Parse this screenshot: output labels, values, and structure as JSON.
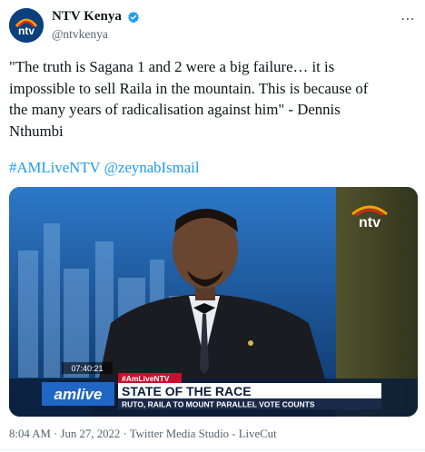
{
  "author": {
    "display_name": "NTV Kenya",
    "handle": "@ntvkenya",
    "verified": true,
    "logo_text": "ntv"
  },
  "more_icon": "ellipsis-icon",
  "tweet": {
    "text": "\"The truth is Sagana 1 and 2 were a big failure… it is\nimpossible to sell Raila in the mountain. This is because of\nthe many years of radicalisation against him\" - Dennis\nNthumbi",
    "hashtag": "#AMLiveNTV",
    "mention": "@zeynabIsmail"
  },
  "video": {
    "channel_logo": "ntv",
    "timestamp": "07:40:21",
    "show_logo": "amlive",
    "ticker_tag": "#AmLiveNTV",
    "headline": "STATE OF THE RACE",
    "subheadline": "RUTO, RAILA TO MOUNT PARALLEL VOTE COUNTS"
  },
  "meta": {
    "time": "8:04 AM",
    "date": "Jun 27, 2022",
    "source": "Twitter Media Studio - LiveCut",
    "separator": " · "
  },
  "colors": {
    "link": "#1d9bf0",
    "muted": "#536471",
    "ticker_red": "#c8102e"
  }
}
